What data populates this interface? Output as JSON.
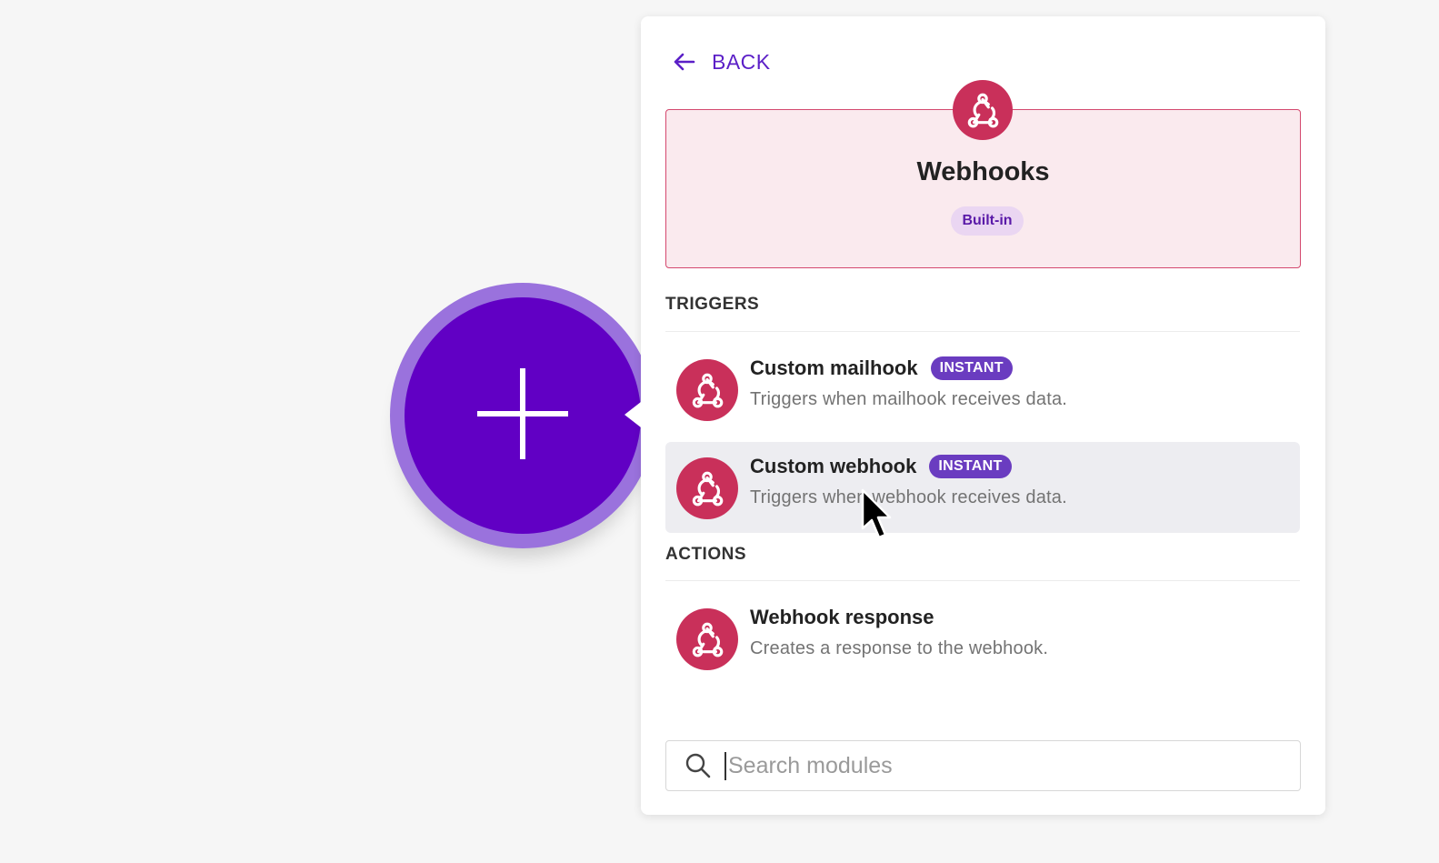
{
  "add_button": {
    "icon": "plus-icon",
    "color": "#6100c4",
    "ring_color": "#9a72dd"
  },
  "panel": {
    "back_label": "BACK",
    "app": {
      "name": "Webhooks",
      "badge": "Built-in",
      "icon": "webhook-icon",
      "brand_color": "#c9305a"
    },
    "sections": [
      {
        "title": "TRIGGERS",
        "modules": [
          {
            "name": "Custom mailhook",
            "badge": "INSTANT",
            "description": "Triggers when mailhook receives data."
          },
          {
            "name": "Custom webhook",
            "badge": "INSTANT",
            "description": "Triggers when webhook receives data."
          }
        ]
      },
      {
        "title": "ACTIONS",
        "modules": [
          {
            "name": "Webhook response",
            "badge": "",
            "description": "Creates a response to the webhook."
          }
        ]
      }
    ],
    "search": {
      "placeholder": "Search modules",
      "value": ""
    }
  }
}
